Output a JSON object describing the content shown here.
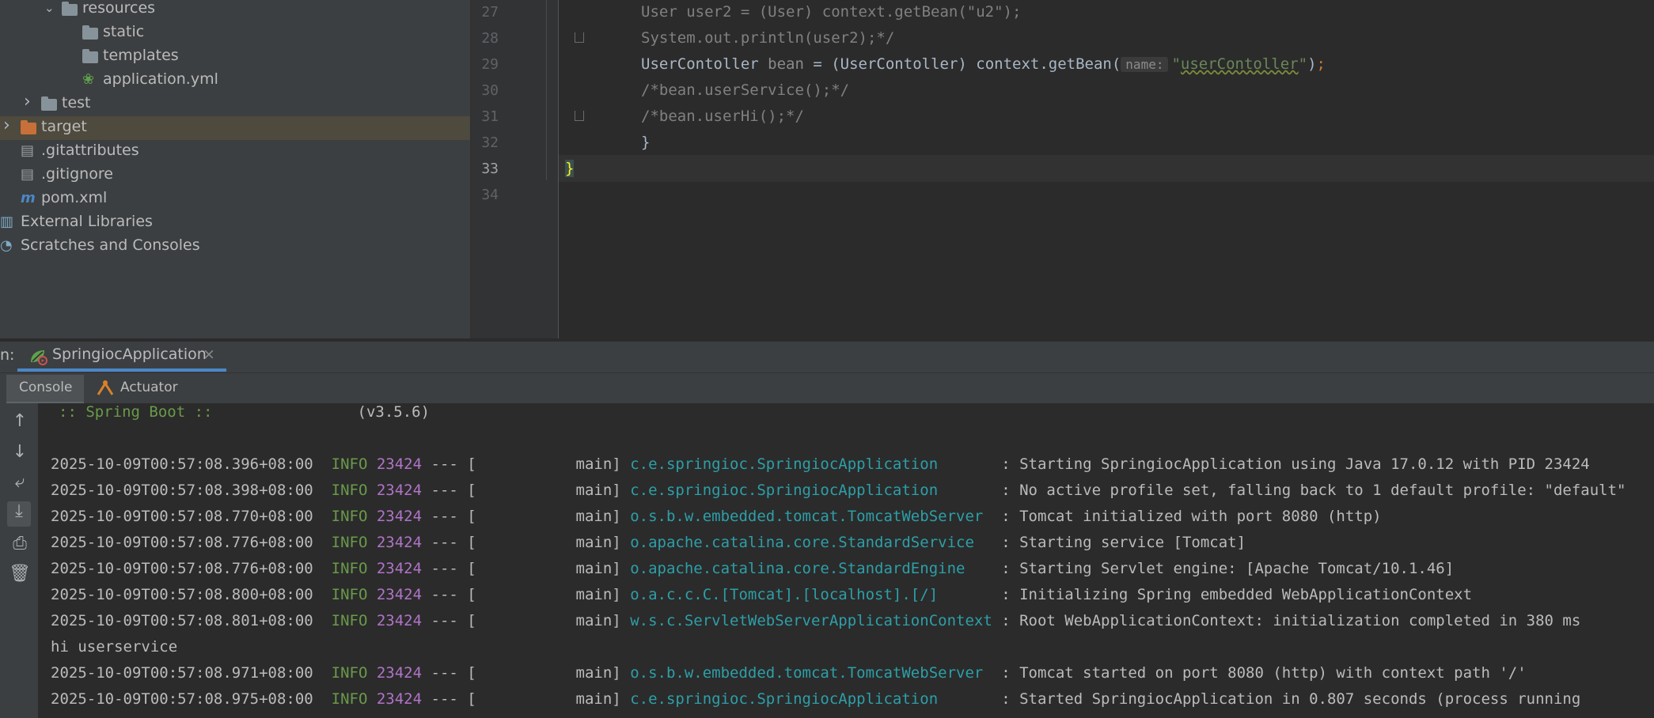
{
  "project_tree": {
    "items": [
      {
        "label": "resources",
        "type": "folder-resources",
        "indent": 2,
        "expanded": true
      },
      {
        "label": "static",
        "type": "folder",
        "indent": 3
      },
      {
        "label": "templates",
        "type": "folder",
        "indent": 3
      },
      {
        "label": "application.yml",
        "type": "spring-config",
        "indent": 3
      },
      {
        "label": "test",
        "type": "folder",
        "indent": 1,
        "expanded": false
      },
      {
        "label": "target",
        "type": "folder-excluded",
        "indent": 0,
        "expanded": false,
        "selected": true
      },
      {
        "label": ".gitattributes",
        "type": "file",
        "indent": 0
      },
      {
        "label": ".gitignore",
        "type": "file",
        "indent": 0
      },
      {
        "label": "pom.xml",
        "type": "maven",
        "indent": 0
      },
      {
        "label": "External Libraries",
        "type": "libraries",
        "indent": -1
      },
      {
        "label": "Scratches and Consoles",
        "type": "scratches",
        "indent": -1
      }
    ]
  },
  "editor": {
    "line_numbers": [
      "27",
      "28",
      "29",
      "30",
      "31",
      "32",
      "33",
      "34"
    ],
    "lines": {
      "l27": "User user2 = (User) context.getBean(\"u2\");",
      "l28": "System.out.println(user2);*/",
      "l29_a": "UserContoller ",
      "l29_var": "bean",
      "l29_b": " = (UserContoller) context.getBean(",
      "l29_hint": "name:",
      "l29_str_q1": "\"",
      "l29_str": "userContoller",
      "l29_str_q2": "\"",
      "l29_c": ")",
      "l29_semi": ";",
      "l30": "/*bean.userService();*/",
      "l31": "/*bean.userHi();*/",
      "l32": "}",
      "l33": "}"
    }
  },
  "run_panel": {
    "prefix": "n:",
    "tab_label": "SpringiocApplication",
    "close_glyph": "×",
    "subtabs": {
      "console": "Console",
      "actuator": "Actuator"
    }
  },
  "console": {
    "banner_left": ":: Spring Boot ::",
    "banner_version": "(v3.5.6)",
    "log": [
      {
        "ts": "2025-10-09T00:57:08.396+08:00",
        "level": "INFO",
        "pid": "23424",
        "sep": "--- [",
        "thread": "main]",
        "logger": "c.e.springioc.SpringiocApplication",
        "msg": ": Starting SpringiocApplication using Java 17.0.12 with PID 23424"
      },
      {
        "ts": "2025-10-09T00:57:08.398+08:00",
        "level": "INFO",
        "pid": "23424",
        "sep": "--- [",
        "thread": "main]",
        "logger": "c.e.springioc.SpringiocApplication",
        "msg": ": No active profile set, falling back to 1 default profile: \"default\""
      },
      {
        "ts": "2025-10-09T00:57:08.770+08:00",
        "level": "INFO",
        "pid": "23424",
        "sep": "--- [",
        "thread": "main]",
        "logger": "o.s.b.w.embedded.tomcat.TomcatWebServer",
        "msg": ": Tomcat initialized with port 8080 (http)"
      },
      {
        "ts": "2025-10-09T00:57:08.776+08:00",
        "level": "INFO",
        "pid": "23424",
        "sep": "--- [",
        "thread": "main]",
        "logger": "o.apache.catalina.core.StandardService",
        "msg": ": Starting service [Tomcat]"
      },
      {
        "ts": "2025-10-09T00:57:08.776+08:00",
        "level": "INFO",
        "pid": "23424",
        "sep": "--- [",
        "thread": "main]",
        "logger": "o.apache.catalina.core.StandardEngine",
        "msg": ": Starting Servlet engine: [Apache Tomcat/10.1.46]"
      },
      {
        "ts": "2025-10-09T00:57:08.800+08:00",
        "level": "INFO",
        "pid": "23424",
        "sep": "--- [",
        "thread": "main]",
        "logger": "o.a.c.c.C.[Tomcat].[localhost].[/]",
        "msg": ": Initializing Spring embedded WebApplicationContext"
      },
      {
        "ts": "2025-10-09T00:57:08.801+08:00",
        "level": "INFO",
        "pid": "23424",
        "sep": "--- [",
        "thread": "main]",
        "logger": "w.s.c.ServletWebServerApplicationContext",
        "msg": ": Root WebApplicationContext: initialization completed in 380 ms"
      },
      {
        "plain": "hi userservice"
      },
      {
        "ts": "2025-10-09T00:57:08.971+08:00",
        "level": "INFO",
        "pid": "23424",
        "sep": "--- [",
        "thread": "main]",
        "logger": "o.s.b.w.embedded.tomcat.TomcatWebServer",
        "msg": ": Tomcat started on port 8080 (http) with context path '/'"
      },
      {
        "ts": "2025-10-09T00:57:08.975+08:00",
        "level": "INFO",
        "pid": "23424",
        "sep": "--- [",
        "thread": "main]",
        "logger": "c.e.springioc.SpringiocApplication",
        "msg": ": Started SpringiocApplication in 0.807 seconds (process running"
      }
    ]
  },
  "colors": {
    "panel_bg": "#3c3f41",
    "editor_bg": "#2b2b2b",
    "selected_row": "#4e4a3d",
    "accent": "#4a88c7",
    "info_green": "#6a9a4a",
    "pid_purple": "#b074c8",
    "logger_cyan": "#2d9fa8"
  },
  "toolbar_icons": [
    "arrow-up-icon",
    "arrow-down-icon",
    "soft-wrap-icon",
    "scroll-to-end-icon",
    "print-icon",
    "trash-icon"
  ]
}
